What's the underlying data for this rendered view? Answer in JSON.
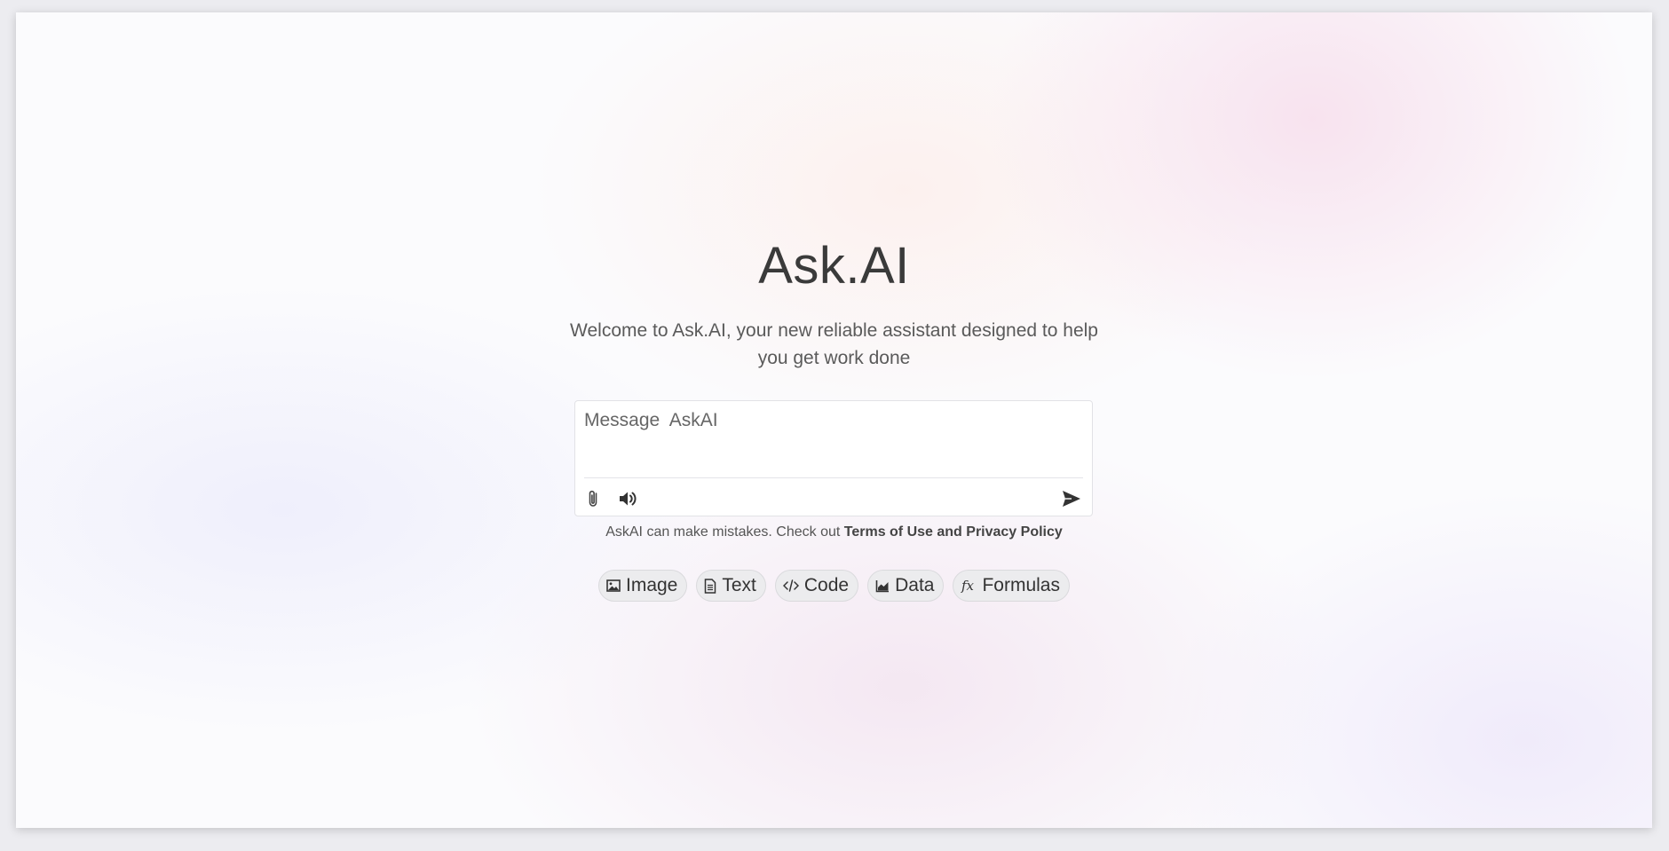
{
  "app": {
    "title": "Ask.AI",
    "subtitle": "Welcome to Ask.AI, your new reliable assistant designed to help you get work done"
  },
  "composer": {
    "placeholder": "Message  AskAI",
    "value": "",
    "attach_icon": "paperclip-icon",
    "voice_icon": "speaker-icon",
    "send_icon": "send-icon"
  },
  "disclaimer": {
    "text": "AskAI can make mistakes. Check out ",
    "link": "Terms of Use and Privacy Policy"
  },
  "chips": [
    {
      "label": "Image",
      "icon": "image-icon"
    },
    {
      "label": "Text",
      "icon": "document-icon"
    },
    {
      "label": "Code",
      "icon": "code-icon"
    },
    {
      "label": "Data",
      "icon": "chart-icon"
    },
    {
      "label": "Formulas",
      "icon": "function-icon"
    }
  ],
  "colors": {
    "text": "#3a3a3a",
    "chip_bg": "#ececee"
  }
}
